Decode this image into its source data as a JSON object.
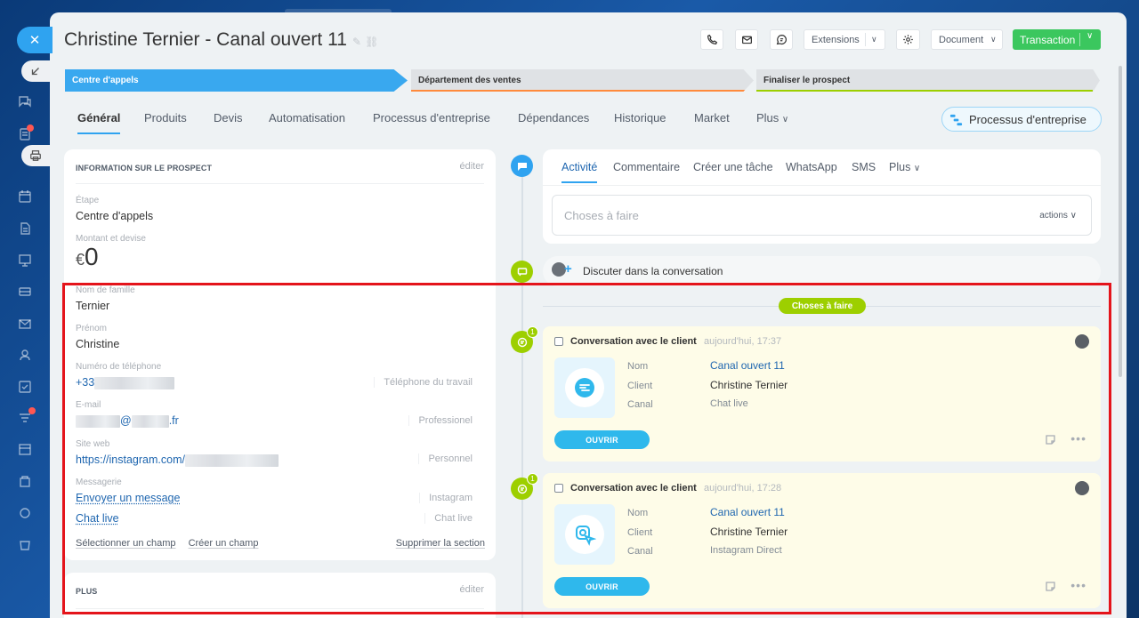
{
  "page": {
    "title": "Christine Ternier - Canal ouvert 11"
  },
  "header": {
    "extensions_label": "Extensions",
    "document_label": "Document",
    "transaction_label": "Transaction",
    "caret": "∨"
  },
  "stages": [
    {
      "label": "Centre d'appels",
      "color": "#39a8ef"
    },
    {
      "label": "Département des ventes",
      "color": "#ff8a3c"
    },
    {
      "label": "Finaliser le prospect",
      "color": "#9dcf00"
    }
  ],
  "tabs": [
    {
      "label": "Général"
    },
    {
      "label": "Produits"
    },
    {
      "label": "Devis"
    },
    {
      "label": "Automatisation"
    },
    {
      "label": "Processus d'entreprise"
    },
    {
      "label": "Dépendances"
    },
    {
      "label": "Historique"
    },
    {
      "label": "Market"
    },
    {
      "label": "Plus"
    }
  ],
  "bp_button_label": "Processus d'entreprise",
  "info": {
    "section_title": "INFORMATION SUR LE PROSPECT",
    "edit_label": "éditer",
    "stage_label": "Étape",
    "stage_value": "Centre d'appels",
    "amount_label": "Montant et devise",
    "amount_currency": "€",
    "amount_value": "0",
    "lastname_label": "Nom de famille",
    "lastname_value": "Ternier",
    "firstname_label": "Prénom",
    "firstname_value": "Christine",
    "phone_label": "Numéro de téléphone",
    "phone_prefix": "+33",
    "phone_type": "Téléphone du travail",
    "email_label": "E-mail",
    "email_at": "@",
    "email_suffix": ".fr",
    "email_type": "Professionel",
    "website_label": "Site web",
    "website_value": "https://instagram.com/",
    "website_type": "Personnel",
    "messenger_label": "Messagerie",
    "messenger_1_value": "Envoyer un message",
    "messenger_1_type": "Instagram",
    "messenger_2_value": "Chat live",
    "messenger_2_type": "Chat live",
    "select_field": "Sélectionner un champ",
    "create_field": "Créer un champ",
    "delete_section": "Supprimer la section"
  },
  "plus_section": {
    "title": "PLUS",
    "edit_label": "éditer"
  },
  "activity": {
    "tabs": [
      "Activité",
      "Commentaire",
      "Créer une tâche",
      "WhatsApp",
      "SMS",
      "Plus"
    ],
    "todo_placeholder": "Choses à faire",
    "actions_label": "actions"
  },
  "chat_row_label": "Discuter dans la conversation",
  "separator_label": "Choses à faire",
  "conversations": [
    {
      "count": "1",
      "title": "Conversation avec le client",
      "time": "aujourd'hui, 17:37",
      "name_label": "Nom",
      "name_value": "Canal ouvert 11",
      "client_label": "Client",
      "client_value": "Christine Ternier",
      "channel_label": "Canal",
      "channel_value": "Chat live",
      "open_label": "OUVRIR"
    },
    {
      "count": "1",
      "title": "Conversation avec le client",
      "time": "aujourd'hui, 17:28",
      "name_label": "Nom",
      "name_value": "Canal ouvert 11",
      "client_label": "Client",
      "client_value": "Christine Ternier",
      "channel_label": "Canal",
      "channel_value": "Instagram Direct",
      "open_label": "OUVRIR"
    }
  ],
  "icons": {
    "close": "close-icon",
    "phone": "phone-icon",
    "mail": "mail-icon",
    "chat": "chat-icon",
    "gear": "gear-icon",
    "edit": "pencil-icon",
    "link": "link-icon"
  },
  "colors": {
    "accent": "#2fa3f0",
    "success": "#3bc75e",
    "highlight": "#e4141b",
    "todo": "#9dcf00"
  }
}
